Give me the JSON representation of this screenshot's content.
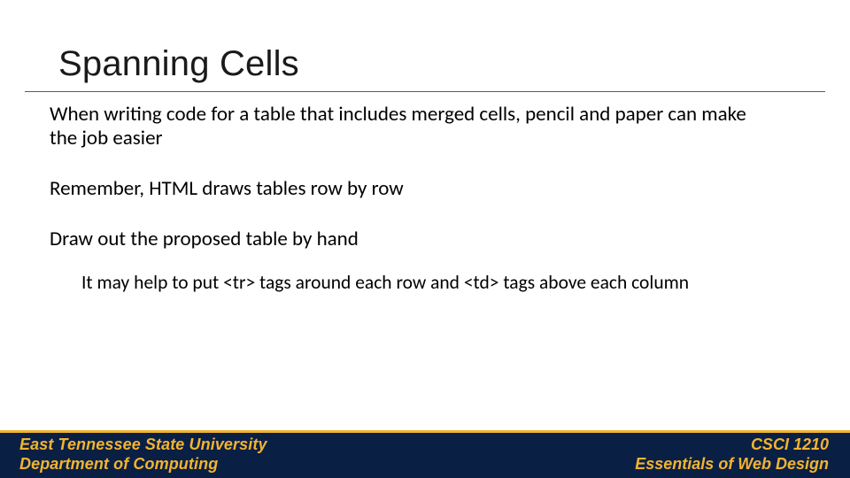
{
  "title": "Spanning Cells",
  "body": {
    "p1": "When writing code for a table that includes merged cells, pencil and paper can make the job easier",
    "p2": "Remember, HTML draws tables row by row",
    "p3": "Draw out the proposed table by hand",
    "sub": "It may help to put <tr> tags around each row and <td> tags above each column"
  },
  "footer": {
    "institution": "East Tennessee State University",
    "department": "Department of Computing",
    "course": "CSCI 1210",
    "subtitle": "Essentials of Web Design"
  },
  "colors": {
    "footer_bg": "#0a1f44",
    "accent": "#f2b430"
  }
}
